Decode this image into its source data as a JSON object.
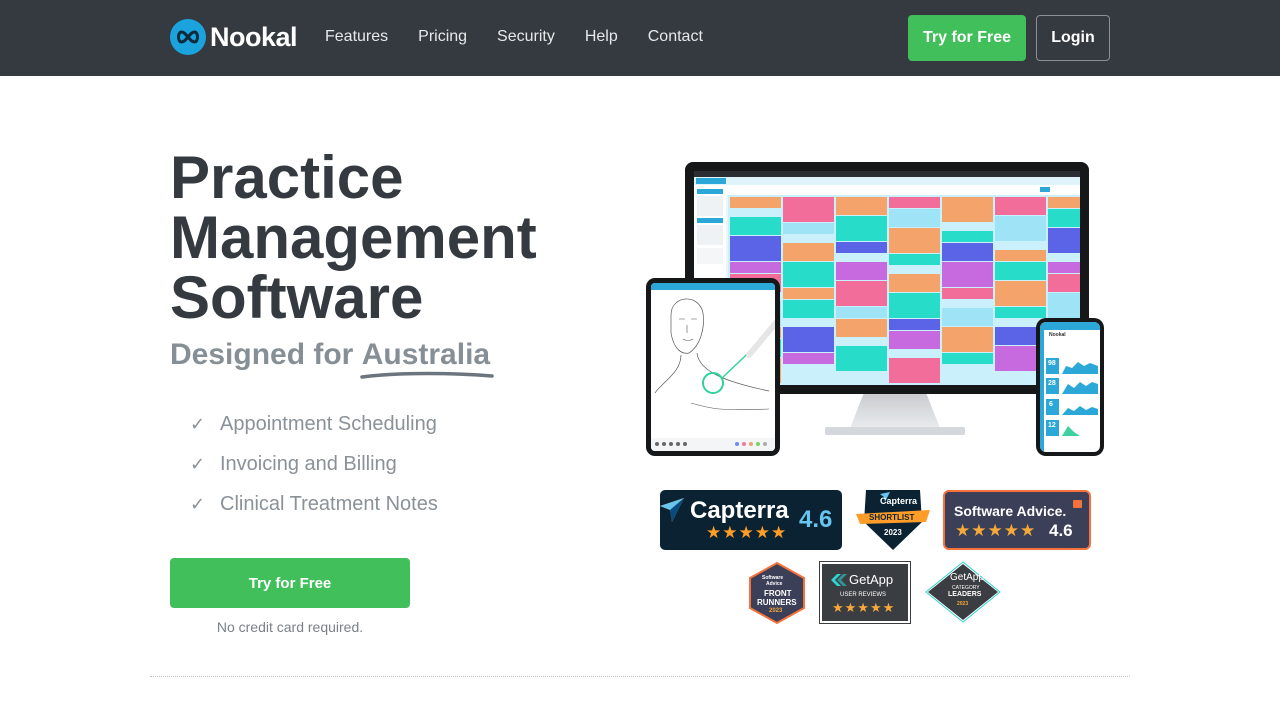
{
  "nav": {
    "logo_text": "Nookal",
    "links": [
      "Features",
      "Pricing",
      "Security",
      "Help",
      "Contact"
    ],
    "try_label": "Try for Free",
    "login_label": "Login"
  },
  "hero": {
    "title_lines": [
      "Practice",
      "Management",
      "Software"
    ],
    "subtitle_prefix": "Designed for",
    "subtitle_country": "Australia",
    "features": [
      "Appointment Scheduling",
      "Invoicing and Billing",
      "Clinical Treatment Notes"
    ],
    "check_glyph": "✓",
    "cta_label": "Try for Free",
    "cta_note": "No credit card required."
  },
  "badges": {
    "capterra": {
      "name": "Capterra",
      "rating": "4.6",
      "stars": 4.5
    },
    "capterra_shortlist": {
      "name": "Capterra",
      "label": "SHORTLIST",
      "year": "2023"
    },
    "software_advice": {
      "name": "Software Advice.",
      "rating": "4.6",
      "stars": 4.5
    },
    "front_runners": {
      "line1": "Software",
      "line2": "Advice",
      "line3": "FRONT",
      "line4": "RUNNERS",
      "year": "2023"
    },
    "getapp_reviews": {
      "name": "GetApp",
      "label": "USER REVIEWS",
      "stars": 4.5
    },
    "getapp_leaders": {
      "name": "GetApp",
      "line1": "CATEGORY",
      "line2": "LEADERS",
      "year": "2023"
    }
  },
  "phone_stats": [
    "98",
    "28",
    "6",
    "12"
  ],
  "colors": {
    "nav_bg": "#343a40",
    "accent_green": "#41bf5a",
    "brand_blue": "#1aa3dc",
    "capterra_star": "#ff9d28"
  }
}
